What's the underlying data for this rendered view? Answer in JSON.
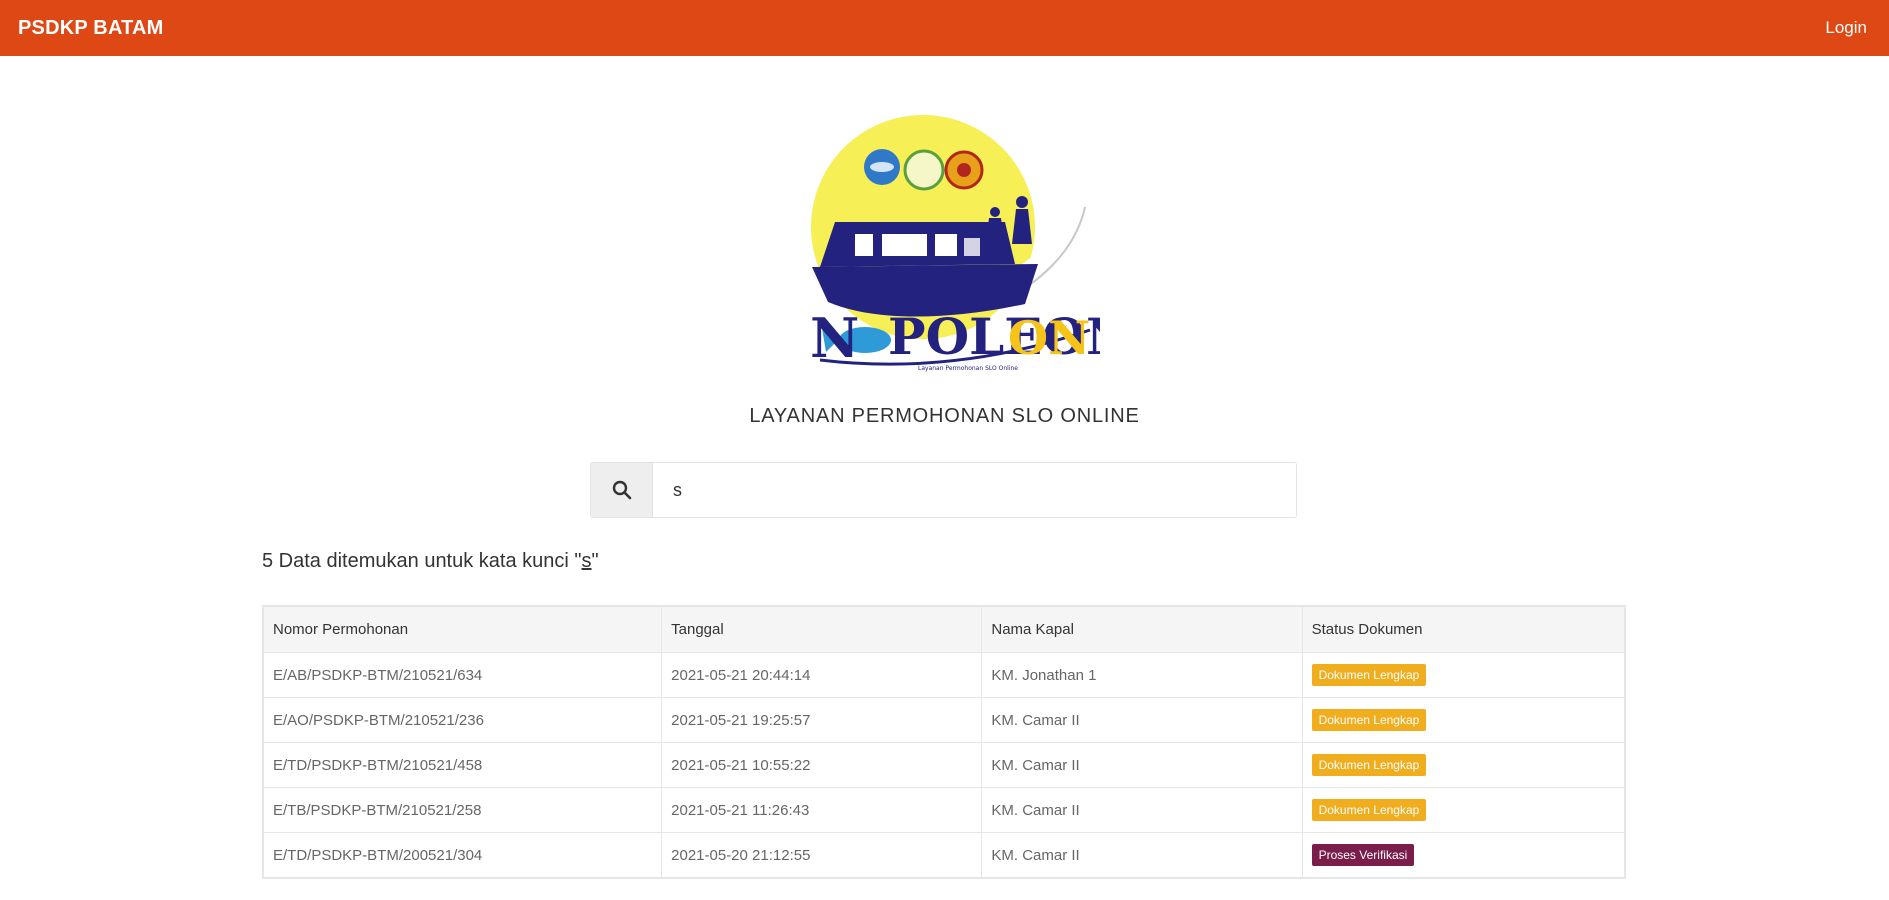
{
  "navbar": {
    "brand": "PSDKP BATAM",
    "login": "Login"
  },
  "logo": {
    "text_main": "POLEON",
    "text_on": "ON",
    "text_n": "N",
    "tagline": "Layanan Permohonan SLO Online"
  },
  "subtitle": "LAYANAN PERMOHONAN SLO ONLINE",
  "search": {
    "icon": "search-icon",
    "value": "s"
  },
  "result": {
    "prefix": "5 Data ditemukan untuk kata kunci \"",
    "keyword": "s",
    "suffix": "\""
  },
  "table": {
    "headers": [
      "Nomor Permohonan",
      "Tanggal",
      "Nama Kapal",
      "Status Dokumen"
    ],
    "rows": [
      {
        "nomor": "E/AB/PSDKP-BTM/210521/634",
        "tanggal": "2021-05-21 20:44:14",
        "kapal": "KM. Jonathan 1",
        "status": "Dokumen Lengkap",
        "status_color": "#f0ad1e"
      },
      {
        "nomor": "E/AO/PSDKP-BTM/210521/236",
        "tanggal": "2021-05-21 19:25:57",
        "kapal": "KM. Camar II",
        "status": "Dokumen Lengkap",
        "status_color": "#f0ad1e"
      },
      {
        "nomor": "E/TD/PSDKP-BTM/210521/458",
        "tanggal": "2021-05-21 10:55:22",
        "kapal": "KM. Camar II",
        "status": "Dokumen Lengkap",
        "status_color": "#f0ad1e"
      },
      {
        "nomor": "E/TB/PSDKP-BTM/210521/258",
        "tanggal": "2021-05-21 11:26:43",
        "kapal": "KM. Camar II",
        "status": "Dokumen Lengkap",
        "status_color": "#f0ad1e"
      },
      {
        "nomor": "E/TD/PSDKP-BTM/200521/304",
        "tanggal": "2021-05-20 21:12:55",
        "kapal": "KM. Camar II",
        "status": "Proses Verifikasi",
        "status_color": "#7a1d4a"
      }
    ]
  },
  "colors": {
    "navbar": "#dd4814",
    "badge_lengkap": "#f0ad1e",
    "badge_verifikasi": "#7a1d4a"
  }
}
